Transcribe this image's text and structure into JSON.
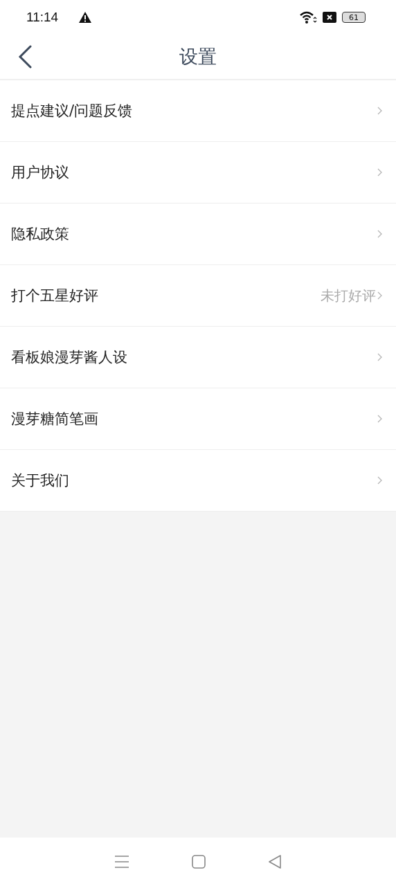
{
  "status_bar": {
    "time": "11:14",
    "battery": "61"
  },
  "header": {
    "title": "设置"
  },
  "items": [
    {
      "label": "提点建议/问题反馈"
    },
    {
      "label": "用户协议"
    },
    {
      "label": "隐私政策"
    },
    {
      "label": "打个五星好评",
      "value": "未打好评"
    },
    {
      "label": "看板娘漫芽酱人设"
    },
    {
      "label": "漫芽糖简笔画"
    },
    {
      "label": "关于我们"
    }
  ]
}
